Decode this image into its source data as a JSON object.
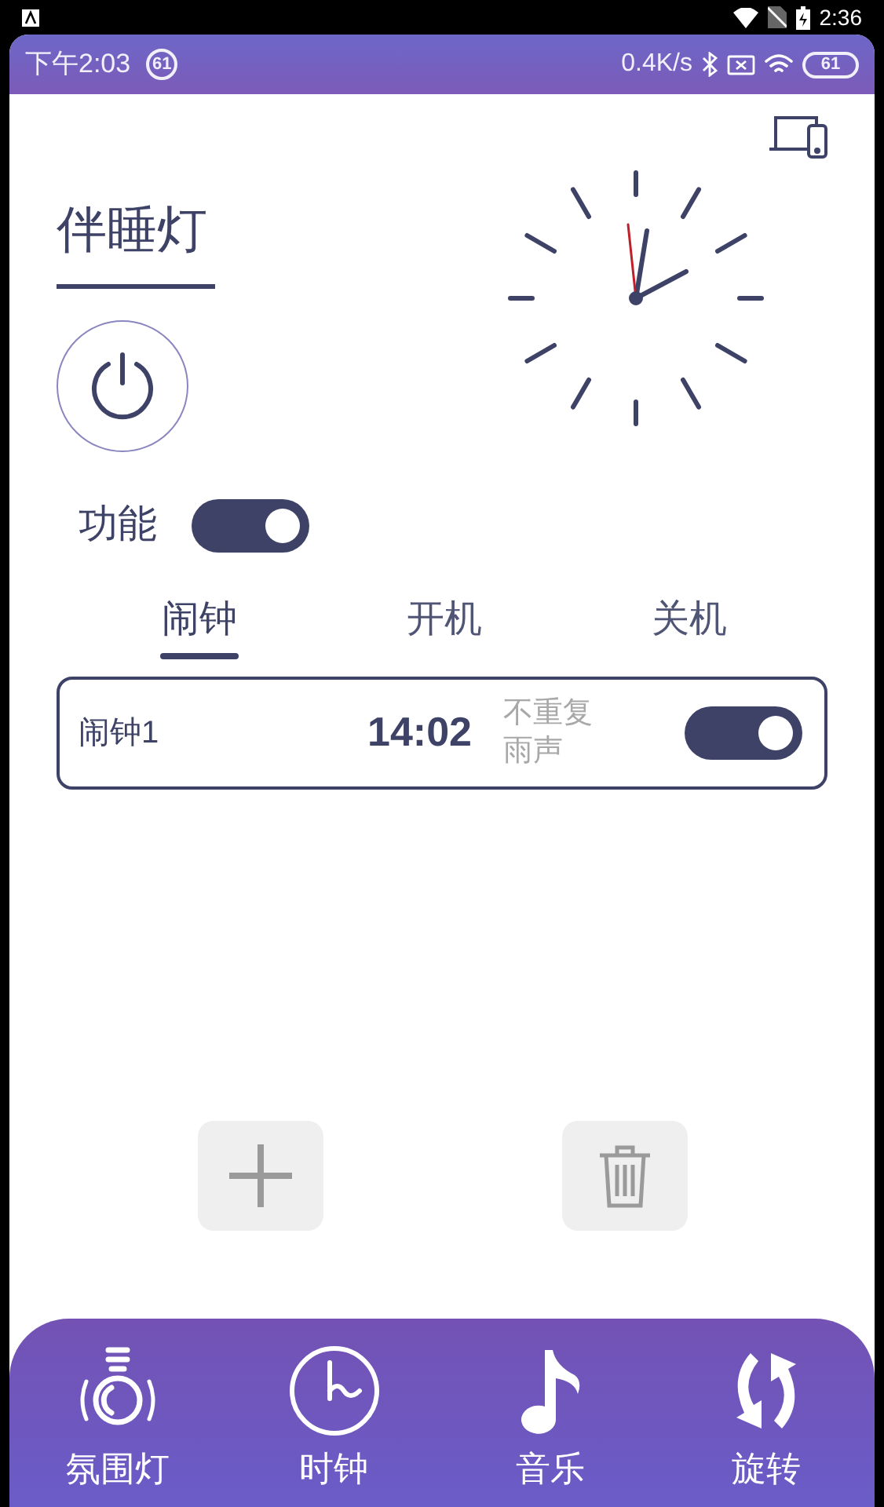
{
  "system_status": {
    "time": "2:36"
  },
  "app_status": {
    "time": "下午2:03",
    "badge": "61",
    "speed": "0.4K/s",
    "battery": "61"
  },
  "title": "伴睡灯",
  "function_toggle": {
    "label": "功能",
    "on": true
  },
  "tabs": [
    {
      "label": "闹钟",
      "selected": true
    },
    {
      "label": "开机",
      "selected": false
    },
    {
      "label": "关机",
      "selected": false
    }
  ],
  "alarms": [
    {
      "name": "闹钟1",
      "time": "14:02",
      "repeat": "不重复",
      "sound": "雨声",
      "on": true
    }
  ],
  "nav": [
    {
      "label": "氛围灯",
      "kind": "lamp"
    },
    {
      "label": "时钟",
      "kind": "clock"
    },
    {
      "label": "音乐",
      "kind": "music"
    },
    {
      "label": "旋转",
      "kind": "rotate"
    }
  ]
}
